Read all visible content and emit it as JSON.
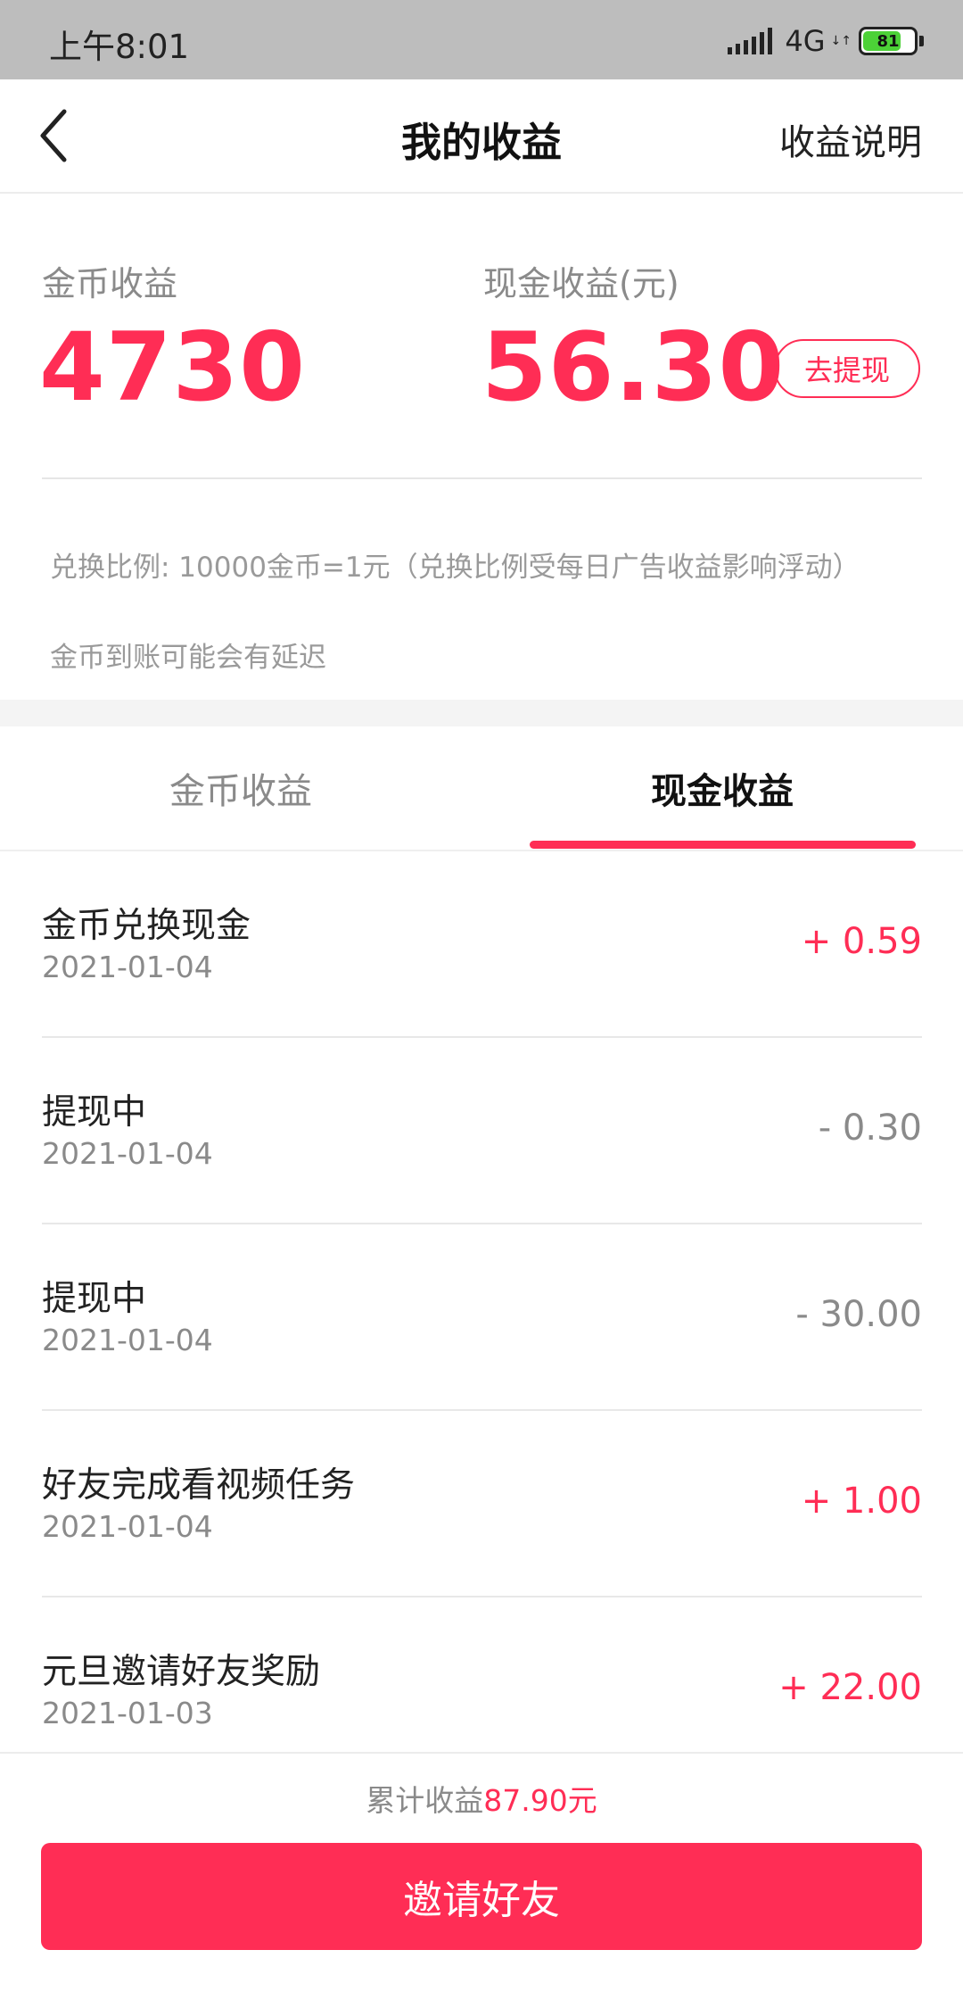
{
  "status_bar": {
    "time": "上午8:01",
    "network": "4G",
    "network_arrows": "↓↑",
    "battery_level": "81",
    "battery_fraction": 0.81
  },
  "nav": {
    "back_icon": "chevron-left-icon",
    "title": "我的收益",
    "right_link": "收益说明"
  },
  "summary": {
    "coin_label": "金币收益",
    "coin_value": "4730",
    "cash_label": "现金收益(元)",
    "cash_value": "56.30",
    "withdraw_label": "去提现",
    "notes": [
      "兑换比例: 10000金币=1元（兑换比例受每日广告收益影响浮动）",
      "金币到账可能会有延迟"
    ]
  },
  "tabs": [
    {
      "label": "金币收益",
      "active": false
    },
    {
      "label": "现金收益",
      "active": true
    }
  ],
  "records": [
    {
      "title": "金币兑换现金",
      "date": "2021-01-04",
      "amount": "+ 0.59",
      "type": "pos"
    },
    {
      "title": "提现中",
      "date": "2021-01-04",
      "amount": "- 0.30",
      "type": "neg"
    },
    {
      "title": "提现中",
      "date": "2021-01-04",
      "amount": "- 30.00",
      "type": "neg"
    },
    {
      "title": "好友完成看视频任务",
      "date": "2021-01-04",
      "amount": "+ 1.00",
      "type": "pos"
    },
    {
      "title": "元旦邀请好友奖励",
      "date": "2021-01-03",
      "amount": "+ 22.00",
      "type": "pos"
    }
  ],
  "footer": {
    "total_prefix": "累计收益",
    "total_amount": "87.90元",
    "invite_label": "邀请好友"
  },
  "colors": {
    "accent": "#ff2d55",
    "muted": "#8a8a8a",
    "statusbar": "#bdbdbd",
    "battery": "#4cd137"
  }
}
